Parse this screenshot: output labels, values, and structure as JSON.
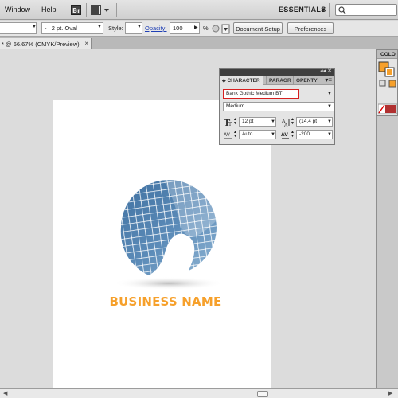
{
  "menubar": {
    "items": [
      {
        "label": "Window"
      },
      {
        "label": "Help"
      }
    ],
    "bridge_icon": "bridge-icon",
    "arrange_icon": "arrange-documents-icon",
    "workspace": "ESSENTIALS",
    "search_icon": "search-icon"
  },
  "control": {
    "stroke_dash": "-",
    "brush": "2 pt. Oval",
    "style_label": "Style:",
    "opacity_label": "Opacity:",
    "opacity_value": "100",
    "percent": "%",
    "doc_setup": "Document Setup",
    "preferences": "Preferences"
  },
  "tab": {
    "title": "* @ 66.67% (CMYK/Preview)",
    "close": "×"
  },
  "artwork": {
    "business_name": "BUSINESS NAME",
    "globe_color_dark": "#3d6f9f",
    "globe_color_light": "#a7c8e0",
    "accent": "#f6a02b"
  },
  "character_panel": {
    "tabs": [
      {
        "label": "CHARACTER"
      },
      {
        "label": "PARAGR"
      },
      {
        "label": "OPENTY"
      }
    ],
    "font_family": "Bank Gothic Medium BT",
    "font_style": "Medium",
    "font_size": "12 pt",
    "leading": "(14.4 pt",
    "kerning": "Auto",
    "tracking": "-200"
  },
  "color_panel": {
    "title": "COLO"
  }
}
